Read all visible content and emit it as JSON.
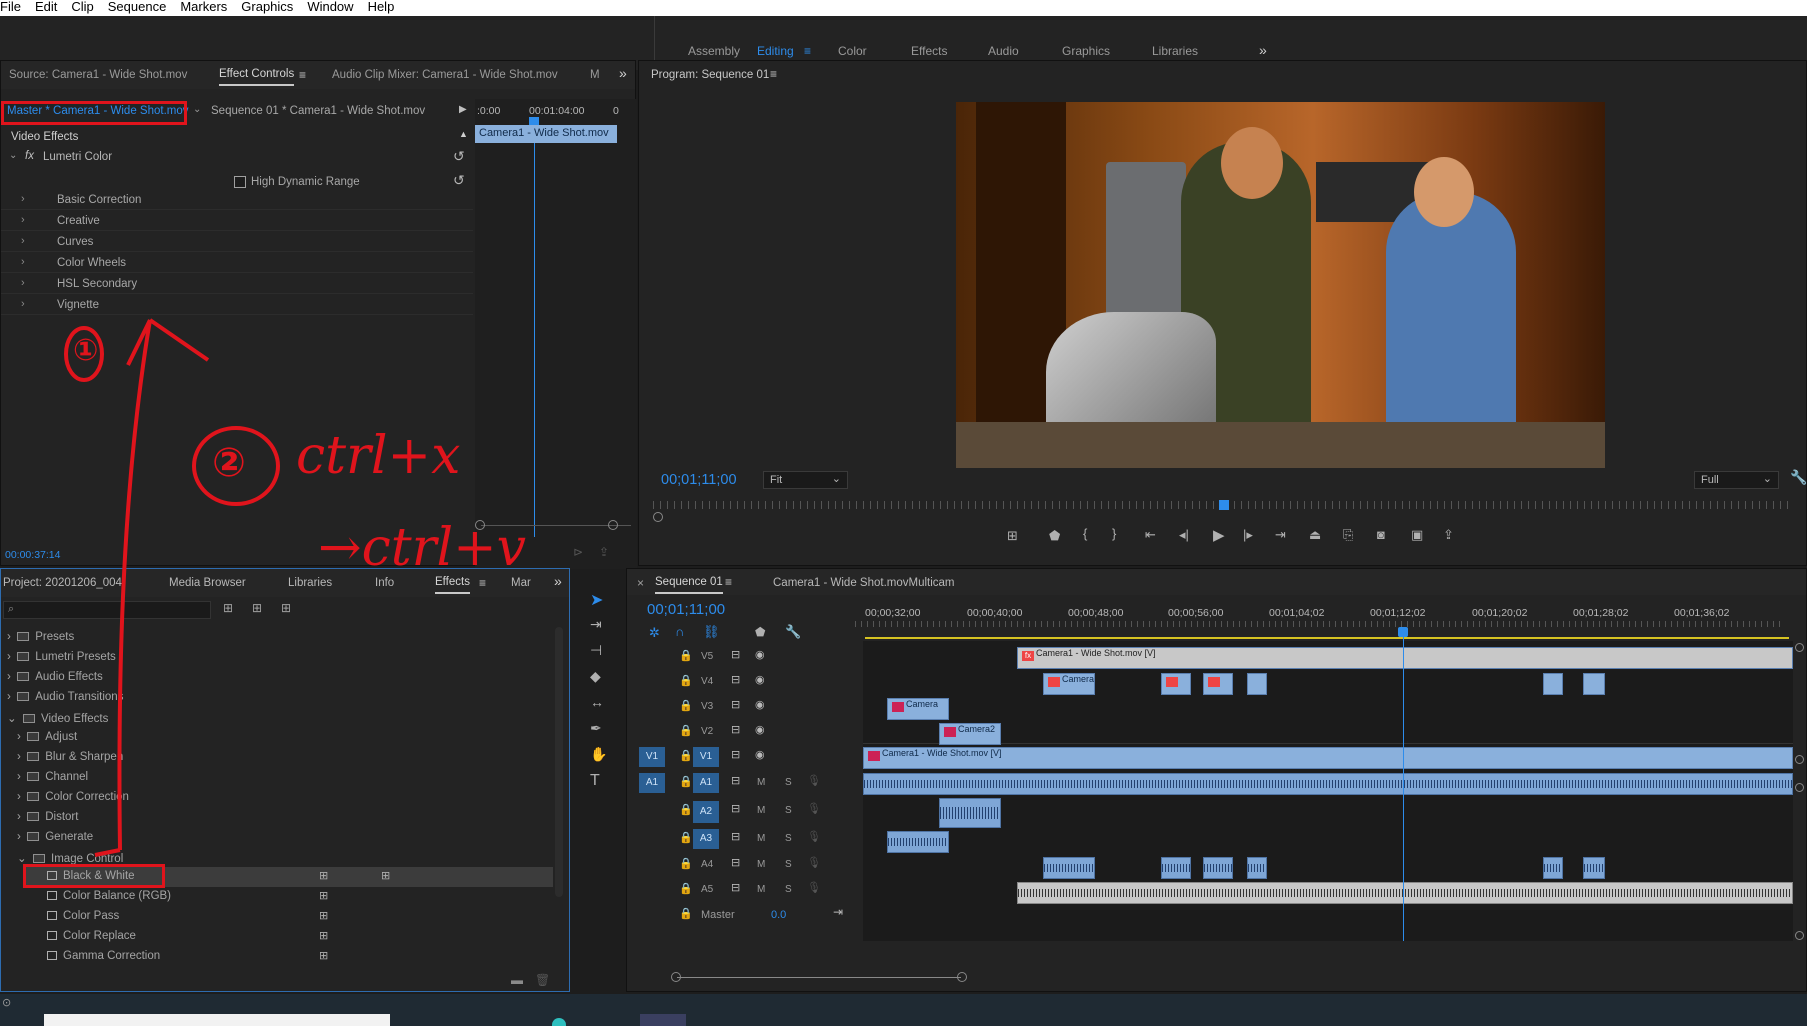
{
  "menu": [
    "File",
    "Edit",
    "Clip",
    "Sequence",
    "Markers",
    "Graphics",
    "Window",
    "Help"
  ],
  "workspaces": {
    "tabs": [
      "Assembly",
      "Editing",
      "Color",
      "Effects",
      "Audio",
      "Graphics",
      "Libraries"
    ],
    "active": "Editing",
    "overflow": "»"
  },
  "source_panel": {
    "tabs": [
      "Source: Camera1 - Wide Shot.mov",
      "Effect Controls",
      "Audio Clip Mixer: Camera1 - Wide Shot.mov",
      "M"
    ],
    "active_tab": "Effect Controls",
    "master_clip": "Master * Camera1 - Wide Shot.mov",
    "sequence_clip": "Sequence 01 * Camera1 - Wide Shot.mov",
    "mini_timeline_start": ":0:00",
    "mini_timeline_time": "00:01:04:00",
    "mini_timeline_end": "0",
    "mini_clip": "Camera1 - Wide Shot.mov",
    "video_effects_label": "Video Effects",
    "effect_name": "Lumetri Color",
    "hdr_label": "High Dynamic Range",
    "sections": [
      "Basic Correction",
      "Creative",
      "Curves",
      "Color Wheels",
      "HSL Secondary",
      "Vignette"
    ],
    "timecode": "00:00:37:14"
  },
  "program_panel": {
    "title": "Program: Sequence 01",
    "timecode": "00;01;11;00",
    "fit": "Fit",
    "quality": "Full"
  },
  "project_panel": {
    "tabs": [
      "Project: 20201206_004",
      "Media Browser",
      "Libraries",
      "Info",
      "Effects",
      "Mar"
    ],
    "active_tab": "Effects",
    "search_placeholder": "",
    "tree": [
      {
        "label": "Presets",
        "level": 0,
        "expanded": false
      },
      {
        "label": "Lumetri Presets",
        "level": 0,
        "expanded": false
      },
      {
        "label": "Audio Effects",
        "level": 0,
        "expanded": false
      },
      {
        "label": "Audio Transitions",
        "level": 0,
        "expanded": false
      },
      {
        "label": "Video Effects",
        "level": 0,
        "expanded": true
      },
      {
        "label": "Adjust",
        "level": 1,
        "expanded": false
      },
      {
        "label": "Blur & Sharpen",
        "level": 1,
        "expanded": false
      },
      {
        "label": "Channel",
        "level": 1,
        "expanded": false
      },
      {
        "label": "Color Correction",
        "level": 1,
        "expanded": false
      },
      {
        "label": "Distort",
        "level": 1,
        "expanded": false
      },
      {
        "label": "Generate",
        "level": 1,
        "expanded": false
      },
      {
        "label": "Image Control",
        "level": 1,
        "expanded": true
      }
    ],
    "effects": [
      "Black & White",
      "Color Balance (RGB)",
      "Color Pass",
      "Color Replace",
      "Gamma Correction"
    ],
    "selected_effect": "Black & White"
  },
  "timeline_panel": {
    "tabs": [
      "Sequence 01",
      "Camera1 - Wide Shot.movMulticam"
    ],
    "active_tab": "Sequence 01",
    "timecode": "00;01;11;00",
    "ruler": [
      "00;00;32;00",
      "00;00;40;00",
      "00;00;48;00",
      "00;00;56;00",
      "00;01;04;02",
      "00;01;12;02",
      "00;01;20;02",
      "00;01;28;02",
      "00;01;36;02"
    ],
    "video_tracks": [
      "V5",
      "V4",
      "V3",
      "V2",
      "V1"
    ],
    "audio_tracks": [
      "A1",
      "A2",
      "A3",
      "A4",
      "A5"
    ],
    "source_patch_v": "V1",
    "source_patch_a": "A1",
    "clip_v5": "Camera1 - Wide Shot.mov [V]",
    "clip_v1": "Camera1 - Wide Shot.mov [V]",
    "clip_short": "Camera",
    "clip_short_v3": "Camera",
    "clip_short_v2": "Camera2",
    "mute": "M",
    "solo": "S",
    "master_label": "Master",
    "master_value": "0.0"
  },
  "annotations": {
    "step1": "①",
    "step2": "②",
    "shortcut_cut": "ctrl+x",
    "shortcut_paste": "→ctrl+v"
  },
  "colors": {
    "accent": "#2d8ceb",
    "highlight_box": "#e0141c",
    "clip_video": "#8ab0dc",
    "clip_audio": "#7ea6d6"
  }
}
